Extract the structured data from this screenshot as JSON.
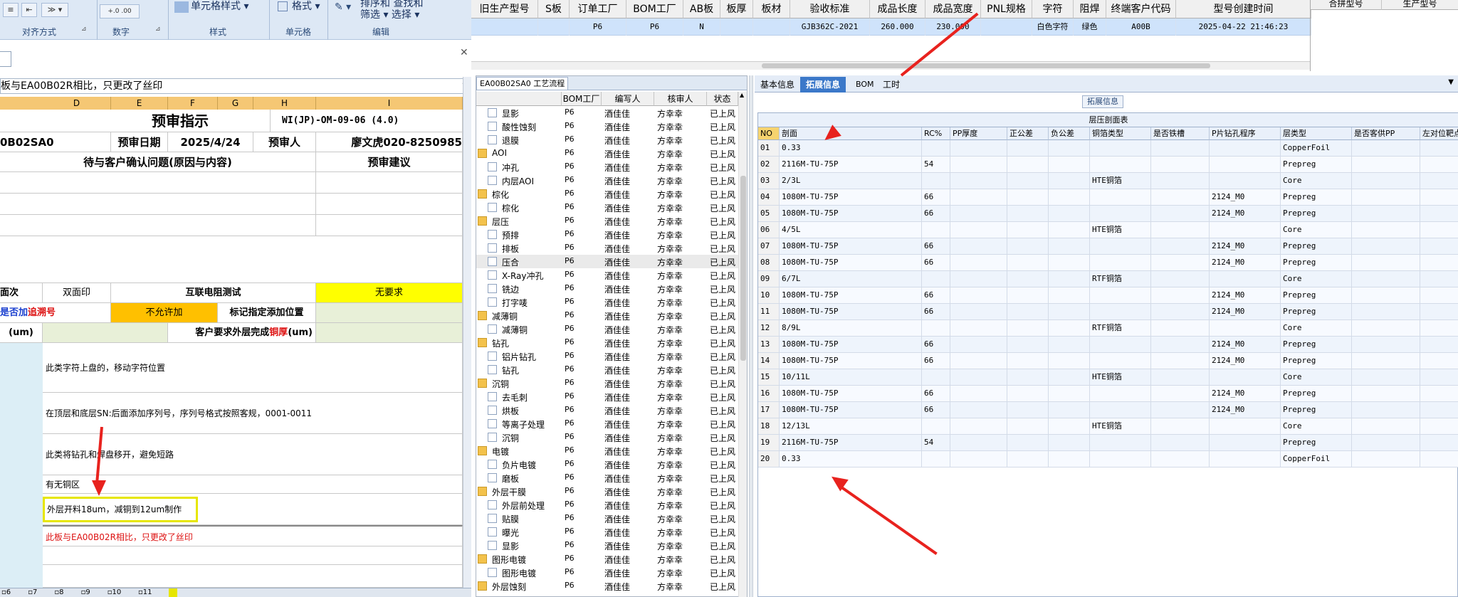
{
  "ribbon": {
    "icons": [
      "≡",
      "⇤",
      "≫ ▾",
      "+.0 .00",
      "",
      ""
    ],
    "items": [
      "单元格样式 ▾",
      "格式 ▾",
      "排序和 查找和",
      "筛选 ▾ 选择 ▾"
    ],
    "groups": [
      "对齐方式",
      "数字",
      "样式",
      "单元格",
      "编辑"
    ]
  },
  "excel": {
    "formula_text": "板与EA00B02R相比，只更改了丝印",
    "columns": [
      "D",
      "E",
      "F",
      "G",
      "H",
      "I"
    ],
    "title": "预审指示",
    "doc_code": "WI(JP)-OM-09-06 (4.0)",
    "part_no": "0B02SA0",
    "date_label": "预审日期",
    "date_value": "2025/4/24",
    "person_label": "预审人",
    "person_value": "廖文虎020-8250985",
    "issue_header": "待与客户确认问题(原因与内容)",
    "advice_header": "预审建议",
    "row_side_label": "面次",
    "row_side_value": "双面印",
    "row_test_label": "互联电阻测试",
    "row_test_value": "无要求",
    "row_add_label_a": "是否加",
    "row_add_label_b": "追溯号",
    "row_add_value": "不允许加",
    "row_mark_label": "标记指定添加位置",
    "row_um_label": "(um)",
    "row_thick_label_a": "客户要求外层完成",
    "row_thick_label_b": "铜厚",
    "row_thick_unit": "(um)",
    "notes": [
      "此类字符上盘的，移动字符位置",
      "在顶层和底层SN:后面添加序列号，序列号格式按照客规，0001-0011",
      "此类将钻孔和焊盘移开，避免短路",
      "有无铜区",
      "外层开料18um，减铜到12um制作",
      "此板与EA00B02R相比，只更改了丝印"
    ],
    "sheet_tabs": [
      "6",
      "7",
      "8",
      "9",
      "10",
      "11"
    ]
  },
  "top_table": {
    "headers": [
      "旧生产型号",
      "S板",
      "订单工厂",
      "BOM工厂",
      "AB板",
      "板厚",
      "板材",
      "验收标准",
      "成品长度",
      "成品宽度",
      "PNL规格",
      "字符",
      "阻焊",
      "终端客户代码",
      "型号创建时间"
    ],
    "row": [
      "",
      "",
      "P6",
      "P6",
      "N",
      "",
      "",
      "GJB362C-2021",
      "260.000",
      "230.000",
      "",
      "白色字符",
      "绿色",
      "A00B",
      "2025-04-22 21:46:23"
    ],
    "right_headers": [
      "合拼型号",
      "生产型号"
    ]
  },
  "process": {
    "tab_label": "EA00B02SA0 工艺流程",
    "headers": [
      "",
      "BOM工厂",
      "编写人",
      "核审人",
      "状态"
    ],
    "rows": [
      {
        "name": "显影",
        "folder": false,
        "bom": "P6",
        "writer": "酒佳佳",
        "checker": "方幸幸",
        "status": "已上风"
      },
      {
        "name": "酸性蚀刻",
        "folder": false,
        "bom": "P6",
        "writer": "酒佳佳",
        "checker": "方幸幸",
        "status": "已上风"
      },
      {
        "name": "退膜",
        "folder": false,
        "bom": "P6",
        "writer": "酒佳佳",
        "checker": "方幸幸",
        "status": "已上风"
      },
      {
        "name": "AOI",
        "folder": true,
        "bom": "P6",
        "writer": "酒佳佳",
        "checker": "方幸幸",
        "status": "已上风"
      },
      {
        "name": "冲孔",
        "folder": false,
        "bom": "P6",
        "writer": "酒佳佳",
        "checker": "方幸幸",
        "status": "已上风"
      },
      {
        "name": "内层AOI",
        "folder": false,
        "bom": "P6",
        "writer": "酒佳佳",
        "checker": "方幸幸",
        "status": "已上风"
      },
      {
        "name": "棕化",
        "folder": true,
        "bom": "P6",
        "writer": "酒佳佳",
        "checker": "方幸幸",
        "status": "已上风"
      },
      {
        "name": "棕化",
        "folder": false,
        "bom": "P6",
        "writer": "酒佳佳",
        "checker": "方幸幸",
        "status": "已上风"
      },
      {
        "name": "层压",
        "folder": true,
        "bom": "P6",
        "writer": "酒佳佳",
        "checker": "方幸幸",
        "status": "已上风"
      },
      {
        "name": "预排",
        "folder": false,
        "bom": "P6",
        "writer": "酒佳佳",
        "checker": "方幸幸",
        "status": "已上风"
      },
      {
        "name": "排板",
        "folder": false,
        "bom": "P6",
        "writer": "酒佳佳",
        "checker": "方幸幸",
        "status": "已上风"
      },
      {
        "name": "压合",
        "folder": false,
        "bom": "P6",
        "writer": "酒佳佳",
        "checker": "方幸幸",
        "status": "已上风"
      },
      {
        "name": "X-Ray冲孔",
        "folder": false,
        "bom": "P6",
        "writer": "酒佳佳",
        "checker": "方幸幸",
        "status": "已上风"
      },
      {
        "name": "铣边",
        "folder": false,
        "bom": "P6",
        "writer": "酒佳佳",
        "checker": "方幸幸",
        "status": "已上风"
      },
      {
        "name": "打字唛",
        "folder": false,
        "bom": "P6",
        "writer": "酒佳佳",
        "checker": "方幸幸",
        "status": "已上风"
      },
      {
        "name": "减薄铜",
        "folder": true,
        "bom": "P6",
        "writer": "酒佳佳",
        "checker": "方幸幸",
        "status": "已上风"
      },
      {
        "name": "减薄铜",
        "folder": false,
        "bom": "P6",
        "writer": "酒佳佳",
        "checker": "方幸幸",
        "status": "已上风"
      },
      {
        "name": "钻孔",
        "folder": true,
        "bom": "P6",
        "writer": "酒佳佳",
        "checker": "方幸幸",
        "status": "已上风"
      },
      {
        "name": "铝片钻孔",
        "folder": false,
        "bom": "P6",
        "writer": "酒佳佳",
        "checker": "方幸幸",
        "status": "已上风"
      },
      {
        "name": "钻孔",
        "folder": false,
        "bom": "P6",
        "writer": "酒佳佳",
        "checker": "方幸幸",
        "status": "已上风"
      },
      {
        "name": "沉铜",
        "folder": true,
        "bom": "P6",
        "writer": "酒佳佳",
        "checker": "方幸幸",
        "status": "已上风"
      },
      {
        "name": "去毛刺",
        "folder": false,
        "bom": "P6",
        "writer": "酒佳佳",
        "checker": "方幸幸",
        "status": "已上风"
      },
      {
        "name": "烘板",
        "folder": false,
        "bom": "P6",
        "writer": "酒佳佳",
        "checker": "方幸幸",
        "status": "已上风"
      },
      {
        "name": "等离子处理",
        "folder": false,
        "bom": "P6",
        "writer": "酒佳佳",
        "checker": "方幸幸",
        "status": "已上风"
      },
      {
        "name": "沉铜",
        "folder": false,
        "bom": "P6",
        "writer": "酒佳佳",
        "checker": "方幸幸",
        "status": "已上风"
      },
      {
        "name": "电镀",
        "folder": true,
        "bom": "P6",
        "writer": "酒佳佳",
        "checker": "方幸幸",
        "status": "已上风"
      },
      {
        "name": "负片电镀",
        "folder": false,
        "bom": "P6",
        "writer": "酒佳佳",
        "checker": "方幸幸",
        "status": "已上风"
      },
      {
        "name": "磨板",
        "folder": false,
        "bom": "P6",
        "writer": "酒佳佳",
        "checker": "方幸幸",
        "status": "已上风"
      },
      {
        "name": "外层干膜",
        "folder": true,
        "bom": "P6",
        "writer": "酒佳佳",
        "checker": "方幸幸",
        "status": "已上风"
      },
      {
        "name": "外层前处理",
        "folder": false,
        "bom": "P6",
        "writer": "酒佳佳",
        "checker": "方幸幸",
        "status": "已上风"
      },
      {
        "name": "贴膜",
        "folder": false,
        "bom": "P6",
        "writer": "酒佳佳",
        "checker": "方幸幸",
        "status": "已上风"
      },
      {
        "name": "曝光",
        "folder": false,
        "bom": "P6",
        "writer": "酒佳佳",
        "checker": "方幸幸",
        "status": "已上风"
      },
      {
        "name": "显影",
        "folder": false,
        "bom": "P6",
        "writer": "酒佳佳",
        "checker": "方幸幸",
        "status": "已上风"
      },
      {
        "name": "图形电镀",
        "folder": true,
        "bom": "P6",
        "writer": "酒佳佳",
        "checker": "方幸幸",
        "status": "已上风"
      },
      {
        "name": "图形电镀",
        "folder": false,
        "bom": "P6",
        "writer": "酒佳佳",
        "checker": "方幸幸",
        "status": "已上风"
      },
      {
        "name": "外层蚀刻",
        "folder": true,
        "bom": "P6",
        "writer": "酒佳佳",
        "checker": "方幸幸",
        "status": "已上风"
      }
    ]
  },
  "detail": {
    "tabs": [
      "基本信息",
      "拓展信息",
      "BOM",
      "工时"
    ],
    "active_tab": "拓展信息",
    "group_label": "拓展信息",
    "grid_title": "层压剖面表",
    "headers": [
      "NO",
      "剖面",
      "RC%",
      "PP厚度",
      "正公差",
      "负公差",
      "铜箔类型",
      "是否铁槽",
      "P片钻孔程序",
      "层类型",
      "是否客供PP",
      "左对位靶点"
    ],
    "rows": [
      [
        "01",
        "0.33",
        "",
        "",
        "",
        "",
        "",
        "",
        "",
        "CopperFoil",
        "",
        ""
      ],
      [
        "02",
        "2116M-TU-75P",
        "54",
        "",
        "",
        "",
        "",
        "",
        "",
        "Prepreg",
        "",
        ""
      ],
      [
        "03",
        "2/3L",
        "",
        "",
        "",
        "",
        "HTE铜箔",
        "",
        "",
        "Core",
        "",
        ""
      ],
      [
        "04",
        "1080M-TU-75P",
        "66",
        "",
        "",
        "",
        "",
        "",
        "2124_M0",
        "Prepreg",
        "",
        ""
      ],
      [
        "05",
        "1080M-TU-75P",
        "66",
        "",
        "",
        "",
        "",
        "",
        "2124_M0",
        "Prepreg",
        "",
        ""
      ],
      [
        "06",
        "4/5L",
        "",
        "",
        "",
        "",
        "HTE铜箔",
        "",
        "",
        "Core",
        "",
        ""
      ],
      [
        "07",
        "1080M-TU-75P",
        "66",
        "",
        "",
        "",
        "",
        "",
        "2124_M0",
        "Prepreg",
        "",
        ""
      ],
      [
        "08",
        "1080M-TU-75P",
        "66",
        "",
        "",
        "",
        "",
        "",
        "2124_M0",
        "Prepreg",
        "",
        ""
      ],
      [
        "09",
        "6/7L",
        "",
        "",
        "",
        "",
        "RTF铜箔",
        "",
        "",
        "Core",
        "",
        ""
      ],
      [
        "10",
        "1080M-TU-75P",
        "66",
        "",
        "",
        "",
        "",
        "",
        "2124_M0",
        "Prepreg",
        "",
        ""
      ],
      [
        "11",
        "1080M-TU-75P",
        "66",
        "",
        "",
        "",
        "",
        "",
        "2124_M0",
        "Prepreg",
        "",
        ""
      ],
      [
        "12",
        "8/9L",
        "",
        "",
        "",
        "",
        "RTF铜箔",
        "",
        "",
        "Core",
        "",
        ""
      ],
      [
        "13",
        "1080M-TU-75P",
        "66",
        "",
        "",
        "",
        "",
        "",
        "2124_M0",
        "Prepreg",
        "",
        ""
      ],
      [
        "14",
        "1080M-TU-75P",
        "66",
        "",
        "",
        "",
        "",
        "",
        "2124_M0",
        "Prepreg",
        "",
        ""
      ],
      [
        "15",
        "10/11L",
        "",
        "",
        "",
        "",
        "HTE铜箔",
        "",
        "",
        "Core",
        "",
        ""
      ],
      [
        "16",
        "1080M-TU-75P",
        "66",
        "",
        "",
        "",
        "",
        "",
        "2124_M0",
        "Prepreg",
        "",
        ""
      ],
      [
        "17",
        "1080M-TU-75P",
        "66",
        "",
        "",
        "",
        "",
        "",
        "2124_M0",
        "Prepreg",
        "",
        ""
      ],
      [
        "18",
        "12/13L",
        "",
        "",
        "",
        "",
        "HTE铜箔",
        "",
        "",
        "Core",
        "",
        ""
      ],
      [
        "19",
        "2116M-TU-75P",
        "54",
        "",
        "",
        "",
        "",
        "",
        "",
        "Prepreg",
        "",
        ""
      ],
      [
        "20",
        "0.33",
        "",
        "",
        "",
        "",
        "",
        "",
        "",
        "CopperFoil",
        "",
        ""
      ]
    ]
  },
  "colors": {
    "annotation": "#e8221e",
    "highlight_box": "#e6e600",
    "yellow_cell": "#ffff00",
    "orange_cell": "#ffc000",
    "selected_row": "#cfe3fb"
  }
}
